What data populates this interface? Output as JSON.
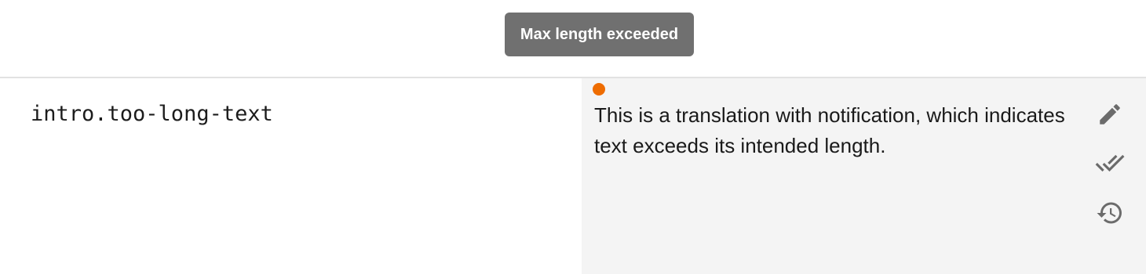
{
  "notification": {
    "message": "Max length exceeded"
  },
  "row": {
    "key": "intro.too-long-text",
    "translation": "This is a translation with notification, which indicates text exceeds its intended length.",
    "status_color": "#ee6c00",
    "actions": [
      {
        "icon": "pencil-icon"
      },
      {
        "icon": "double-check-icon"
      },
      {
        "icon": "history-icon"
      }
    ]
  },
  "colors": {
    "tooltip_bg": "#707070",
    "translation_bg": "#f4f4f4",
    "icon": "#6b6b6b"
  }
}
